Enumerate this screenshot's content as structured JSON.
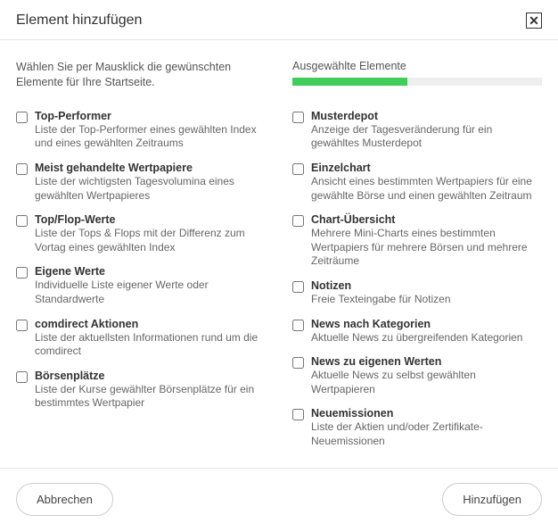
{
  "dialog": {
    "title": "Element hinzufügen",
    "close_glyph": "✕"
  },
  "intro": {
    "text": "Wählen Sie per Mausklick die gewünschten Elemente für Ihre Startseite.",
    "selected_label": "Ausgewählte Elemente",
    "progress_percent": 46
  },
  "left": [
    {
      "title": "Top-Performer",
      "desc": "Liste der Top-Performer eines gewählten Index und eines gewählten Zeitraums"
    },
    {
      "title": "Meist gehandelte Wertpapiere",
      "desc": "Liste der wichtigsten Tagesvolumina eines gewählten Wertpapieres"
    },
    {
      "title": "Top/Flop-Werte",
      "desc": "Liste der Tops & Flops mit der Differenz zum Vortag eines gewählten Index"
    },
    {
      "title": "Eigene Werte",
      "desc": "Individuelle Liste eigener Werte oder Standardwerte"
    },
    {
      "title": "comdirect Aktionen",
      "desc": "Liste der aktuellsten Informationen rund um die comdirect"
    },
    {
      "title": "Börsenplätze",
      "desc": "Liste der Kurse gewählter Börsenplätze für ein bestimmtes Wertpapier"
    }
  ],
  "right": [
    {
      "title": "Musterdepot",
      "desc": "Anzeige der Tagesveränderung für ein gewähltes Musterdepot"
    },
    {
      "title": "Einzelchart",
      "desc": "Ansicht eines bestimmten Wertpapiers für eine gewählte Börse und einen gewählten Zeitraum"
    },
    {
      "title": "Chart-Übersicht",
      "desc": "Mehrere Mini-Charts eines bestimmten Wertpapiers für mehrere Börsen und mehrere Zeiträume"
    },
    {
      "title": "Notizen",
      "desc": "Freie Texteingabe für Notizen"
    },
    {
      "title": "News nach Kategorien",
      "desc": "Aktuelle News zu übergreifenden Kategorien"
    },
    {
      "title": "News zu eigenen Werten",
      "desc": "Aktuelle News zu selbst gewählten Wertpapieren"
    },
    {
      "title": "Neuemissionen",
      "desc": "Liste der Aktien und/oder Zertifikate-Neuemissionen"
    }
  ],
  "footer": {
    "cancel": "Abbrechen",
    "add": "Hinzufügen"
  }
}
